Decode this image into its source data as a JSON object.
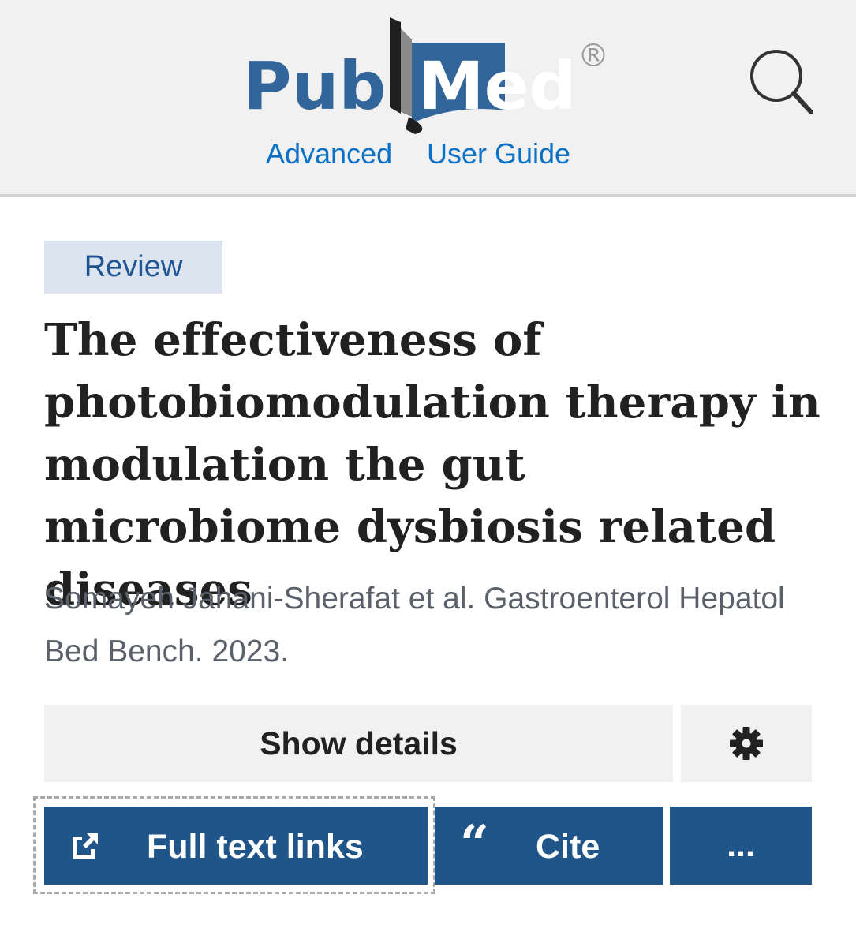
{
  "header": {
    "logo": {
      "word_left": "Pub",
      "word_right": "Med",
      "registered": "®",
      "primary_color": "#326599"
    },
    "links": {
      "advanced": "Advanced",
      "user_guide": "User Guide"
    },
    "search_icon": "search-icon",
    "background": "#f1f1f1"
  },
  "article": {
    "type_badge": "Review",
    "title": "The effectiveness of photobiomodulation therapy in modulation the gut microbiome dysbiosis related diseases",
    "citation": "Somayeh Jahani-Sherafat et al. Gastroenterol Hepatol Bed Bench. 2023."
  },
  "actions": {
    "show_details": "Show details",
    "settings_icon": "gear-icon",
    "full_text": {
      "label": "Full text links",
      "icon": "external-link-icon"
    },
    "cite": {
      "label": "Cite",
      "icon": "quote-icon"
    },
    "more": {
      "label": "...",
      "icon": "more-icon"
    },
    "button_color": "#20558a"
  }
}
